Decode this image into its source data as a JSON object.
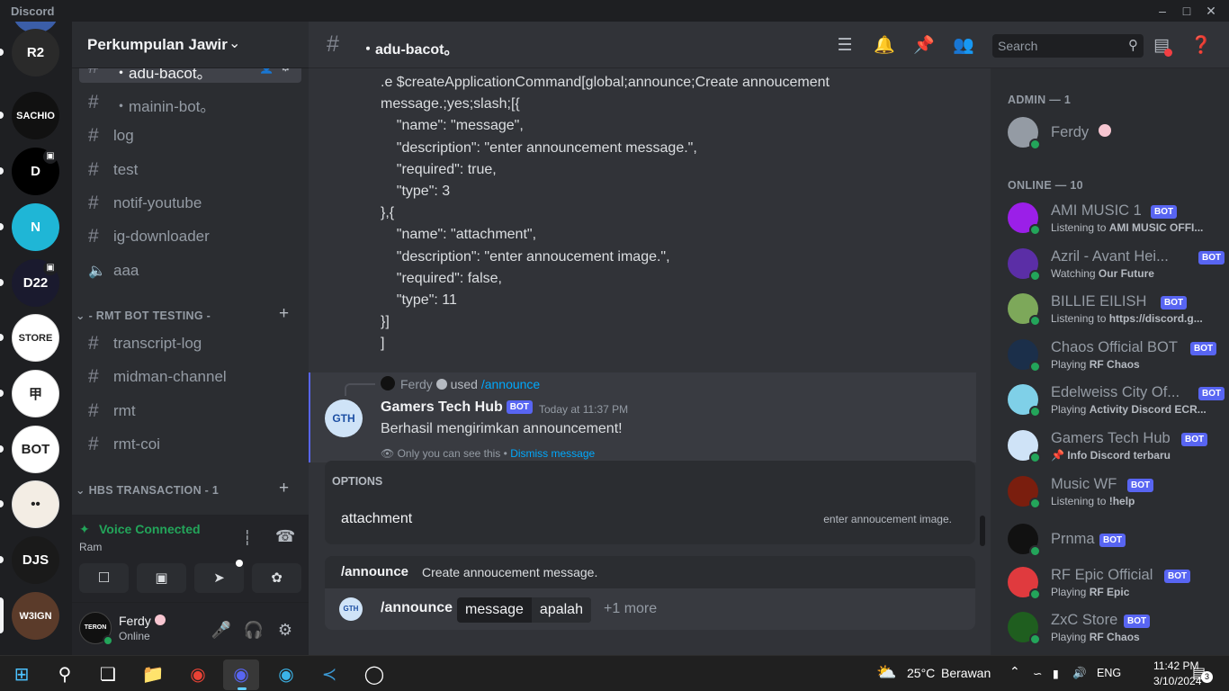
{
  "window": {
    "app_title": "Discord"
  },
  "server": {
    "name": "Perkumpulan Jawir"
  },
  "channels": {
    "top": [
      {
        "name": "・adu-bacot。"
      },
      {
        "name": "・mainin-bot。"
      },
      {
        "name": "log"
      },
      {
        "name": "test"
      },
      {
        "name": "notif-youtube"
      },
      {
        "name": "ig-downloader"
      },
      {
        "name": "aaa"
      }
    ],
    "category_rmt": "- RMT BOT TESTING -",
    "rmt": [
      {
        "name": "transcript-log"
      },
      {
        "name": "midman-channel"
      },
      {
        "name": "rmt"
      },
      {
        "name": "rmt-coi"
      }
    ],
    "category_hbs": "HBS TRANSACTION - 1"
  },
  "voice": {
    "status": "Voice Connected",
    "room": "Ram"
  },
  "user": {
    "name": "Ferdy",
    "status": "Online",
    "avatar_text": "TERON"
  },
  "channel_header": {
    "name": "・adu-bacot。",
    "search_placeholder": "Search"
  },
  "code_lines": [
    ".e $createApplicationCommand[global;announce;Create annoucement",
    "message.;yes;slash;[{",
    "    \"name\": \"message\",",
    "    \"description\": \"enter announcement message.\",",
    "    \"required\": true,",
    "    \"type\": 3",
    "},{",
    "    \"name\": \"attachment\",",
    "    \"description\": \"enter annoucement image.\",",
    "    \"required\": false,",
    "    \"type\": 11",
    "}]",
    "]"
  ],
  "message": {
    "reply_user": "Ferdy",
    "reply_used": "used",
    "reply_command": "/announce",
    "author": "Gamers Tech Hub",
    "bot_tag": "BOT",
    "timestamp": "Today at 11:37 PM",
    "body": "Berhasil mengirimkan announcement!",
    "ephemeral_note": "Only you can see this • ",
    "dismiss": "Dismiss message"
  },
  "options_popup": {
    "header": "OPTIONS",
    "option_name": "attachment",
    "option_desc": "enter annoucement image."
  },
  "command_info": {
    "command": "/announce",
    "description": "Create annoucement message."
  },
  "input": {
    "command": "/announce",
    "option_label": "message",
    "option_value": "apalah",
    "more": "+1 more"
  },
  "members": {
    "admin_header": "ADMIN — 1",
    "online_header": "ONLINE — 10",
    "admin": [
      {
        "name": "Ferdy",
        "color": "#949ba4"
      }
    ],
    "online": [
      {
        "name": "AMI MUSIC 1",
        "activity_prefix": "Listening to ",
        "activity": "AMI MUSIC OFFI...",
        "bot": true,
        "color": "#9b1fe8"
      },
      {
        "name": "Azril - Avant Hei...",
        "activity_prefix": "Watching ",
        "activity": "Our Future",
        "bot": true,
        "color": "#5b2ea6"
      },
      {
        "name": "BILLIE EILISH",
        "activity_prefix": "Listening to ",
        "activity": "https://discord.g...",
        "bot": true,
        "color": "#7da85a"
      },
      {
        "name": "Chaos Official BOT",
        "activity_prefix": "Playing ",
        "activity": "RF Chaos",
        "bot": true,
        "color": "#1b2f4a"
      },
      {
        "name": "Edelweiss City Of...",
        "activity_prefix": "Playing ",
        "activity": "Activity Discord ECR...",
        "bot": true,
        "color": "#7fd0e8"
      },
      {
        "name": "Gamers Tech Hub",
        "activity_prefix": "📌 ",
        "activity": "Info Discord terbaru",
        "bot": true,
        "color": "#cfe3f7"
      },
      {
        "name": "Music WF",
        "activity_prefix": "Listening to ",
        "activity": "!help",
        "bot": true,
        "color": "#7a1e0e"
      },
      {
        "name": "Prnma",
        "activity_prefix": "",
        "activity": "",
        "bot": true,
        "color": "#111111"
      },
      {
        "name": "RF Epic Official",
        "activity_prefix": "Playing ",
        "activity": "RF Epic",
        "bot": true,
        "color": "#e03a3e"
      },
      {
        "name": "ZxC Store",
        "activity_prefix": "Playing ",
        "activity": "RF Chaos",
        "bot": true,
        "color": "#1f5e1f"
      }
    ]
  },
  "guild_icons": [
    {
      "label": "R2",
      "color": "#2a2a2a"
    },
    {
      "label": "SACHIO",
      "color": "#111111"
    },
    {
      "label": "D",
      "color": "#000000"
    },
    {
      "label": "N",
      "color": "#1fb6d6"
    },
    {
      "label": "D22",
      "color": "#1a1a2e"
    },
    {
      "label": "STORE",
      "color": "#ffffff"
    },
    {
      "label": "甲",
      "color": "#ffffff"
    },
    {
      "label": "BOT",
      "color": "#ffffff"
    },
    {
      "label": "••",
      "color": "#f3ede4"
    },
    {
      "label": "DJS",
      "color": "#1a1a1a"
    },
    {
      "label": "W3IGN",
      "color": "#5b3b2a"
    }
  ],
  "taskbar": {
    "weather_temp": "25°C",
    "weather_text": "Berawan",
    "lang": "ENG",
    "time": "11:42 PM",
    "date": "3/10/2024",
    "notif_count": "3"
  }
}
